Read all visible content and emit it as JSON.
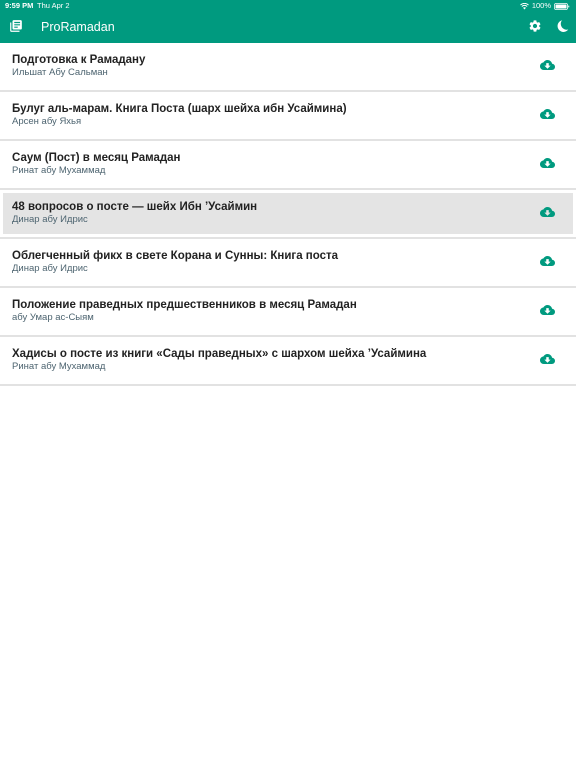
{
  "status_bar": {
    "time": "9:59 PM",
    "date": "Thu Apr 2",
    "battery": "100%"
  },
  "header": {
    "title": "ProRamadan",
    "left_icon": "library-books-icon",
    "right_icons": [
      "settings-gear-icon",
      "moon-icon"
    ]
  },
  "colors": {
    "accent": "#009a7f",
    "row_highlight": "#e4e4e4",
    "subtitle": "#4d6470"
  },
  "items": [
    {
      "title": "Подготовка к Рамадану",
      "author": "Ильшат Абу Сальман",
      "highlighted": false
    },
    {
      "title": "Булуг аль-марам. Книга Поста (шарх шейха ибн Усаймина)",
      "author": "Арсен абу Яхья",
      "highlighted": false
    },
    {
      "title": "Саум (Пост) в месяц Рамадан",
      "author": "Ринат абу Мухаммад",
      "highlighted": false
    },
    {
      "title": "48 вопросов о посте — шейх Ибн ʼУсаймин",
      "author": "Динар абу Идрис",
      "highlighted": true
    },
    {
      "title": "Облегченный фикх в свете Корана и Сунны: Книга поста",
      "author": "Динар абу Идрис",
      "highlighted": false
    },
    {
      "title": "Положение праведных предшественников в месяц Рамадан",
      "author": "абу Умар ас-Сыям",
      "highlighted": false
    },
    {
      "title": "Хадисы о посте из книги «Сады праведных» с шархом шейха ʼУсаймина",
      "author": "Ринат абу Мухаммад",
      "highlighted": false
    }
  ]
}
